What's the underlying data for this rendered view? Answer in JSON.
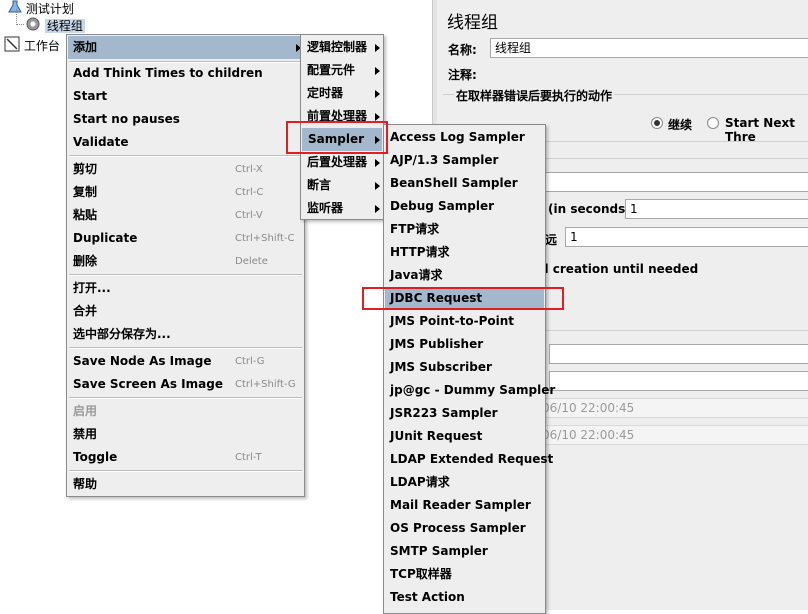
{
  "tree": {
    "test_plan_label": "测试计划",
    "thread_group_label": "线程组",
    "workbench_label": "工作台"
  },
  "panel": {
    "title": "线程组",
    "name_label": "名称:",
    "name_value": "线程组",
    "comments_label": "注释:",
    "error_action_label": "在取样器错误后要执行的动作",
    "continue_label": "继续",
    "start_next_label": "Start Next Thre",
    "ramp_up_label": "(in seconds):",
    "ramp_up_value": "1",
    "loop_label": "远",
    "loop_value": "1",
    "delay_label": "d creation until needed",
    "start_time_value": "06/10 22:00:45",
    "end_time_value": "06/10 22:00:45"
  },
  "context_menu": {
    "add": "添加",
    "add_think_times": "Add Think Times to children",
    "start": "Start",
    "start_no_pauses": "Start no pauses",
    "validate": "Validate",
    "cut": "剪切",
    "cut_sc": "Ctrl-X",
    "copy": "复制",
    "copy_sc": "Ctrl-C",
    "paste": "粘贴",
    "paste_sc": "Ctrl-V",
    "duplicate": "Duplicate",
    "duplicate_sc": "Ctrl+Shift-C",
    "delete": "删除",
    "delete_sc": "Delete",
    "open": "打开...",
    "merge": "合并",
    "save_selection": "选中部分保存为...",
    "save_node_image": "Save Node As Image",
    "save_node_image_sc": "Ctrl-G",
    "save_screen_image": "Save Screen As Image",
    "save_screen_image_sc": "Ctrl+Shift-G",
    "enable": "启用",
    "disable": "禁用",
    "toggle": "Toggle",
    "toggle_sc": "Ctrl-T",
    "help": "帮助"
  },
  "add_menu": {
    "logic_controller": "逻辑控制器",
    "config_element": "配置元件",
    "timer": "定时器",
    "pre_processor": "前置处理器",
    "sampler": "Sampler",
    "post_processor": "后置处理器",
    "assertion": "断言",
    "listener": "监听器"
  },
  "sampler_menu": [
    "Access Log Sampler",
    "AJP/1.3 Sampler",
    "BeanShell Sampler",
    "Debug Sampler",
    "FTP请求",
    "HTTP请求",
    "Java请求",
    "JDBC Request",
    "JMS Point-to-Point",
    "JMS Publisher",
    "JMS Subscriber",
    "jp@gc - Dummy Sampler",
    "JSR223 Sampler",
    "JUnit Request",
    "LDAP Extended Request",
    "LDAP请求",
    "Mail Reader Sampler",
    "OS Process Sampler",
    "SMTP Sampler",
    "TCP取样器",
    "Test Action"
  ],
  "colors": {
    "highlight": "#a3b8cc",
    "annotation_red": "#e02020"
  }
}
